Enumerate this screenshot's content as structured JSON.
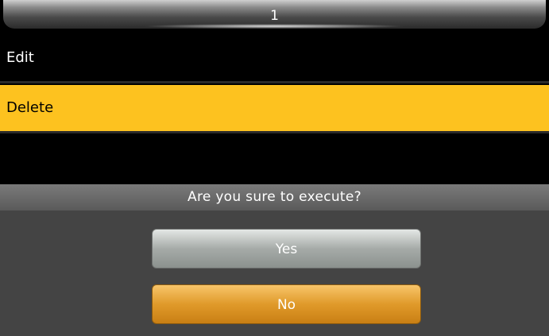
{
  "header": {
    "title": "1"
  },
  "menu": {
    "items": [
      {
        "label": "Edit",
        "selected": false
      },
      {
        "label": "Delete",
        "selected": true
      }
    ]
  },
  "dialog": {
    "message": "Are you sure to execute?",
    "yes_label": "Yes",
    "no_label": "No"
  },
  "colors": {
    "selection": "#fdc21f",
    "background": "#000000",
    "dialog_bg": "#444444",
    "yes_button": "#a6aba8",
    "no_button": "#e09a2a"
  }
}
